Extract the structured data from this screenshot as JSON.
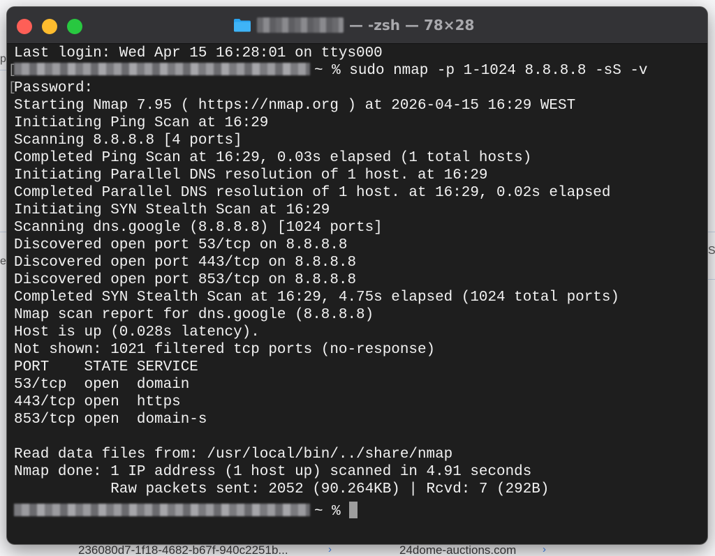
{
  "window": {
    "title": "— -zsh — 78×28"
  },
  "background": {
    "left_fragments": [
      "py",
      "ei"
    ],
    "right_fragment": "S",
    "bottom_items": [
      {
        "label": "236080d7-1f18-4682-b67f-940c2251b..."
      },
      {
        "label": "24dome-auctions.com"
      }
    ]
  },
  "terminal": {
    "lines": [
      "Last login: Wed Apr 15 16:28:01 on ttys000",
      "~ % sudo nmap -p 1-1024 8.8.8.8 -sS -v",
      "Password:",
      "Starting Nmap 7.95 ( https://nmap.org ) at 2026-04-15 16:29 WEST",
      "Initiating Ping Scan at 16:29",
      "Scanning 8.8.8.8 [4 ports]",
      "Completed Ping Scan at 16:29, 0.03s elapsed (1 total hosts)",
      "Initiating Parallel DNS resolution of 1 host. at 16:29",
      "Completed Parallel DNS resolution of 1 host. at 16:29, 0.02s elapsed",
      "Initiating SYN Stealth Scan at 16:29",
      "Scanning dns.google (8.8.8.8) [1024 ports]",
      "Discovered open port 53/tcp on 8.8.8.8",
      "Discovered open port 443/tcp on 8.8.8.8",
      "Discovered open port 853/tcp on 8.8.8.8",
      "Completed SYN Stealth Scan at 16:29, 4.75s elapsed (1024 total ports)",
      "Nmap scan report for dns.google (8.8.8.8)",
      "Host is up (0.028s latency).",
      "Not shown: 1021 filtered tcp ports (no-response)",
      "PORT    STATE SERVICE",
      "53/tcp  open  domain",
      "443/tcp open  https",
      "853/tcp open  domain-s",
      "",
      "Read data files from: /usr/local/bin/../share/nmap",
      "Nmap done: 1 IP address (1 host up) scanned in 4.91 seconds",
      "           Raw packets sent: 2052 (90.264KB) | Rcvd: 7 (292B)",
      "~ %"
    ]
  },
  "colors": {
    "terminal_bg": "#1e1e1e",
    "text": "#f2f2f2",
    "titlebar": "#333336",
    "close": "#fe5f57",
    "minimize": "#febc2e",
    "maximize": "#28c840",
    "accent": "#3b82f6"
  }
}
